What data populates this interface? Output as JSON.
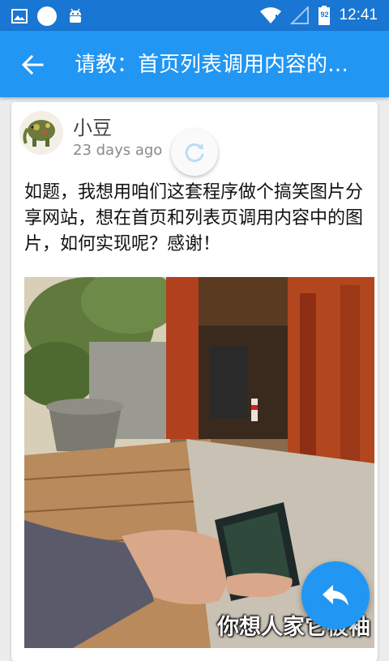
{
  "status_bar": {
    "time": "12:41",
    "battery_level": "92"
  },
  "app_bar": {
    "title": "请教：首页列表调用内容的…"
  },
  "post": {
    "author": "小豆",
    "time_ago": "23 days ago",
    "body": "如题，我想用咱们这套程序做个搞笑图片分享网站，想在首页和列表页调用内容中的图片，如何实现呢？感谢！",
    "image_caption": "你想人家它被袖"
  },
  "icons": {
    "status_left": [
      "gallery-icon",
      "notification-circle-icon",
      "android-icon"
    ],
    "status_right": [
      "wifi-icon",
      "signal-icon",
      "battery-icon"
    ],
    "back": "back-arrow-icon",
    "refresh": "refresh-icon",
    "reply": "reply-icon"
  },
  "colors": {
    "status_bar": "#1976d2",
    "app_bar": "#2196f3",
    "fab": "#2196f3",
    "background": "#ececec"
  }
}
